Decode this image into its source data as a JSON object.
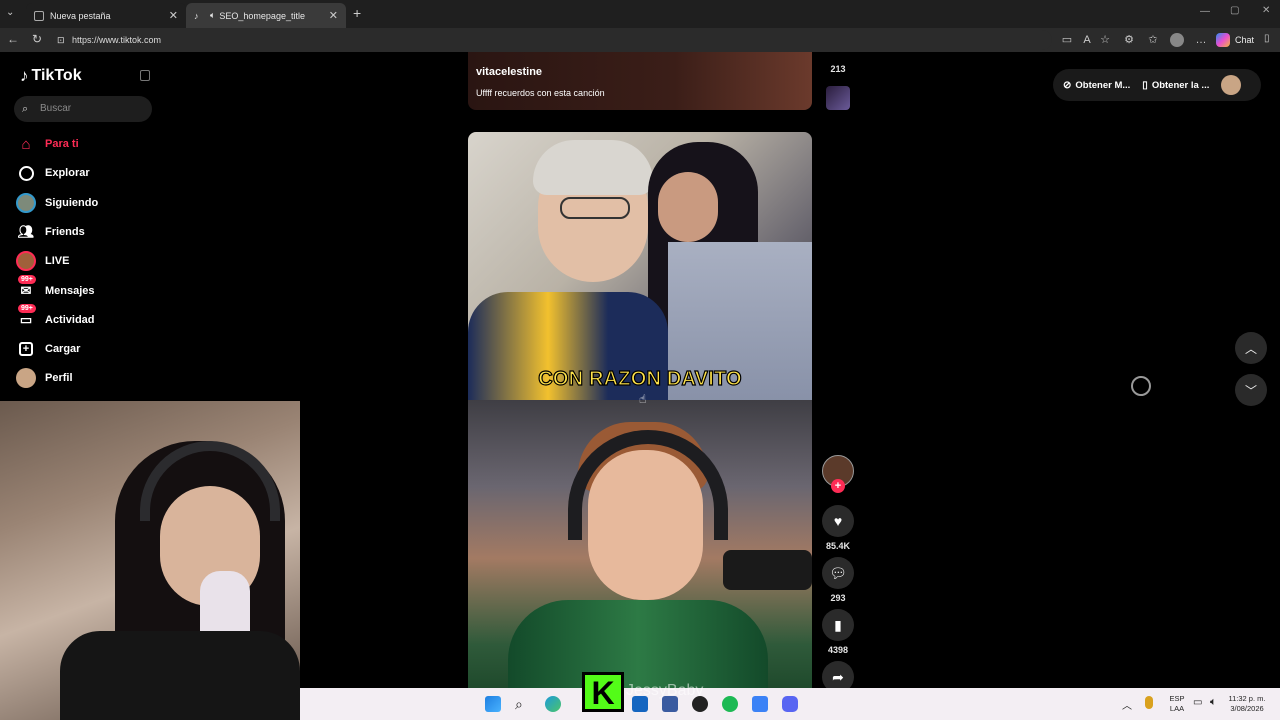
{
  "browser": {
    "tabs": [
      {
        "label": "Nueva pestaña"
      },
      {
        "label": "SEO_homepage_title"
      }
    ],
    "url": "https://www.tiktok.com",
    "chat_label": "Chat"
  },
  "sidebar": {
    "logo": "TikTok",
    "search_placeholder": "Buscar",
    "items": [
      {
        "label": "Para ti",
        "icon": "home-icon",
        "active": true
      },
      {
        "label": "Explorar",
        "icon": "compass-icon"
      },
      {
        "label": "Siguiendo",
        "icon": "following-avatar-icon"
      },
      {
        "label": "Friends",
        "icon": "friends-icon"
      },
      {
        "label": "LIVE",
        "icon": "live-avatar-icon"
      },
      {
        "label": "Mensajes",
        "icon": "messages-icon",
        "badge": "99+"
      },
      {
        "label": "Actividad",
        "icon": "activity-icon",
        "badge": "99+"
      },
      {
        "label": "Cargar",
        "icon": "upload-icon"
      },
      {
        "label": "Perfil",
        "icon": "profile-avatar-icon"
      }
    ]
  },
  "previous_video": {
    "username": "vitacelestine",
    "caption": "Uffff recuerdos con esta canción",
    "share_count": "213"
  },
  "current_video": {
    "overlay_text": "CON RAZON DAVITO",
    "likes": "85.4K",
    "comments": "293",
    "saves": "4398"
  },
  "top_right": {
    "get_app_label": "Obtener M...",
    "get_desktop_label": "Obtener la ..."
  },
  "taskbar": {
    "lang_top": "ESP",
    "lang_bottom": "LAA",
    "time": "11:32 p. m.",
    "date": "3/08/2026",
    "watermark": "JessyBaby"
  },
  "colors": {
    "accent": "#fe2c55",
    "caption_yellow": "#ffe34a"
  }
}
